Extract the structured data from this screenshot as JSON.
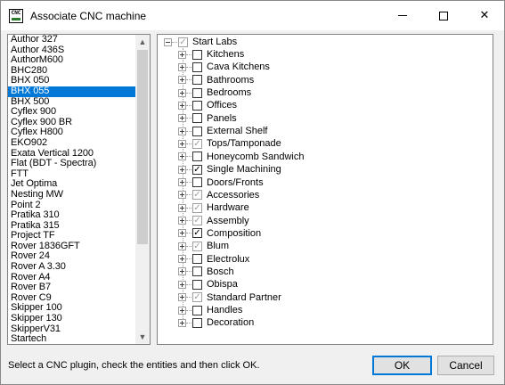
{
  "window": {
    "title": "Associate CNC machine",
    "app_icon_text": "CNC",
    "controls": {
      "minimize": "minimize-icon",
      "maximize": "maximize-icon",
      "close": "✕"
    }
  },
  "machines": {
    "selected": "BHX 055",
    "items": [
      "Author 327",
      "Author 436S",
      "AuthorM600",
      "BHC280",
      "BHX 050",
      "BHX 055",
      "BHX 500",
      "Cyflex 900",
      "Cyflex 900 BR",
      "Cyflex H800",
      "EKO902",
      "Exata Vertical 1200",
      "Flat (BDT - Spectra)",
      "FTT",
      "Jet Optima",
      "Nesting MW",
      "Point 2",
      "Pratika 310",
      "Pratika 315",
      "Project TF",
      "Rover 1836GFT",
      "Rover 24",
      "Rover A 3.30",
      "Rover A4",
      "Rover B7",
      "Rover C9",
      "Skipper 100",
      "Skipper 130",
      "SkipperV31",
      "Startech"
    ]
  },
  "tree": {
    "root": {
      "label": "Start Labs",
      "check": "grey"
    },
    "children": [
      {
        "label": "Kitchens",
        "check": "none"
      },
      {
        "label": "Cava Kitchens",
        "check": "none"
      },
      {
        "label": "Bathrooms",
        "check": "none"
      },
      {
        "label": "Bedrooms",
        "check": "none"
      },
      {
        "label": "Offices",
        "check": "none"
      },
      {
        "label": "Panels",
        "check": "none"
      },
      {
        "label": "External Shelf",
        "check": "none"
      },
      {
        "label": "Tops/Tamponade",
        "check": "grey"
      },
      {
        "label": "Honeycomb Sandwich",
        "check": "none"
      },
      {
        "label": "Single Machining",
        "check": "checked"
      },
      {
        "label": "Doors/Fronts",
        "check": "none"
      },
      {
        "label": "Accessories",
        "check": "grey"
      },
      {
        "label": "Hardware",
        "check": "grey"
      },
      {
        "label": "Assembly",
        "check": "grey"
      },
      {
        "label": "Composition",
        "check": "checked"
      },
      {
        "label": "Blum",
        "check": "grey"
      },
      {
        "label": "Electrolux",
        "check": "none"
      },
      {
        "label": "Bosch",
        "check": "none"
      },
      {
        "label": "Obispa",
        "check": "none"
      },
      {
        "label": "Standard Partner",
        "check": "grey"
      },
      {
        "label": "Handles",
        "check": "none"
      },
      {
        "label": "Decoration",
        "check": "none"
      }
    ]
  },
  "footer": {
    "instruction": "Select a  CNC plugin, check the entities and then click OK.",
    "ok_label": "OK",
    "cancel_label": "Cancel"
  },
  "colors": {
    "selection": "#0078d7",
    "default_button_border": "#0078d7"
  }
}
